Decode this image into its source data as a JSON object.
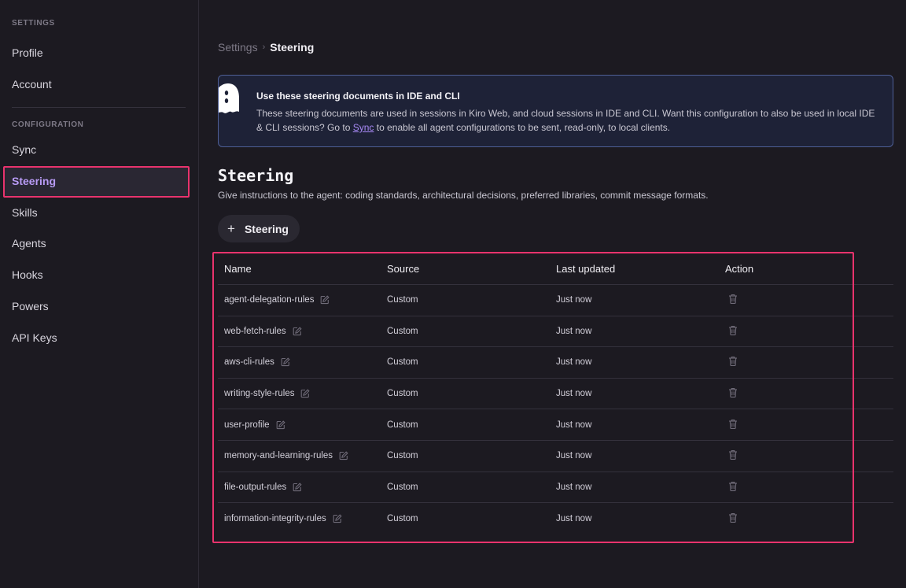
{
  "sidebar": {
    "settings_heading": "SETTINGS",
    "configuration_heading": "CONFIGURATION",
    "items": [
      {
        "label": "Profile"
      },
      {
        "label": "Account"
      },
      {
        "label": "Sync"
      },
      {
        "label": "Steering"
      },
      {
        "label": "Skills"
      },
      {
        "label": "Agents"
      },
      {
        "label": "Hooks"
      },
      {
        "label": "Powers"
      },
      {
        "label": "API Keys"
      }
    ],
    "active_item": "Steering"
  },
  "breadcrumb": {
    "root": "Settings",
    "separator": "›",
    "current": "Steering"
  },
  "banner": {
    "title": "Use these steering documents in IDE and CLI",
    "body_before_link": "These steering documents are used in sessions in Kiro Web, and cloud sessions in IDE and CLI. Want this configuration to also be used in local IDE & CLI sessions? Go to ",
    "link_text": "Sync",
    "body_after_link": " to enable all agent configurations to be sent, read-only, to local clients."
  },
  "section": {
    "title": "Steering",
    "description": "Give instructions to the agent: coding standards, architectural decisions, preferred libraries, commit message formats.",
    "add_button_label": "Steering"
  },
  "table": {
    "headers": {
      "name": "Name",
      "source": "Source",
      "updated": "Last updated",
      "action": "Action"
    },
    "rows": [
      {
        "name": "agent-delegation-rules",
        "source": "Custom",
        "updated": "Just now"
      },
      {
        "name": "web-fetch-rules",
        "source": "Custom",
        "updated": "Just now"
      },
      {
        "name": "aws-cli-rules",
        "source": "Custom",
        "updated": "Just now"
      },
      {
        "name": "writing-style-rules",
        "source": "Custom",
        "updated": "Just now"
      },
      {
        "name": "user-profile",
        "source": "Custom",
        "updated": "Just now"
      },
      {
        "name": "memory-and-learning-rules",
        "source": "Custom",
        "updated": "Just now"
      },
      {
        "name": "file-output-rules",
        "source": "Custom",
        "updated": "Just now"
      },
      {
        "name": "information-integrity-rules",
        "source": "Custom",
        "updated": "Just now"
      }
    ]
  },
  "icons": {
    "edit": "pencil-square-icon",
    "delete": "trash-icon",
    "add": "plus-icon",
    "mascot": "ghost-icon"
  },
  "colors": {
    "accent": "#b89bf5",
    "highlight": "#e8336d",
    "banner_border": "#4e5f96",
    "link": "#a98af7"
  }
}
